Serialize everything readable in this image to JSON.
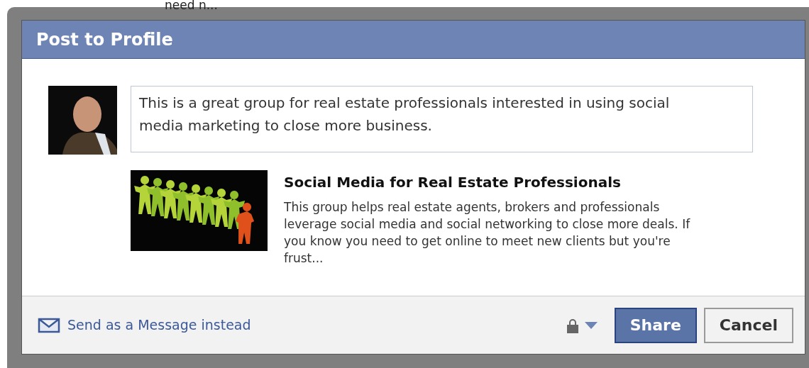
{
  "background": {
    "texts": [
      "need n..."
    ]
  },
  "dialog": {
    "title": "Post to Profile",
    "message": {
      "value": "This is a great group for real estate professionals interested in using social media marketing to close more business."
    },
    "attachment": {
      "kind": "picture",
      "title": "Social Media for Real Estate Professionals",
      "description": "This group helps real estate agents, brokers and professionals leverage social media and social networking to close more deals. If you know you need to get online to meet new clients but you're frust..."
    },
    "footer": {
      "message_link": "Send as a Message instead",
      "buttons": [
        {
          "label": "Share",
          "kind": "primary"
        },
        {
          "label": "Cancel",
          "kind": "secondary"
        }
      ]
    }
  }
}
